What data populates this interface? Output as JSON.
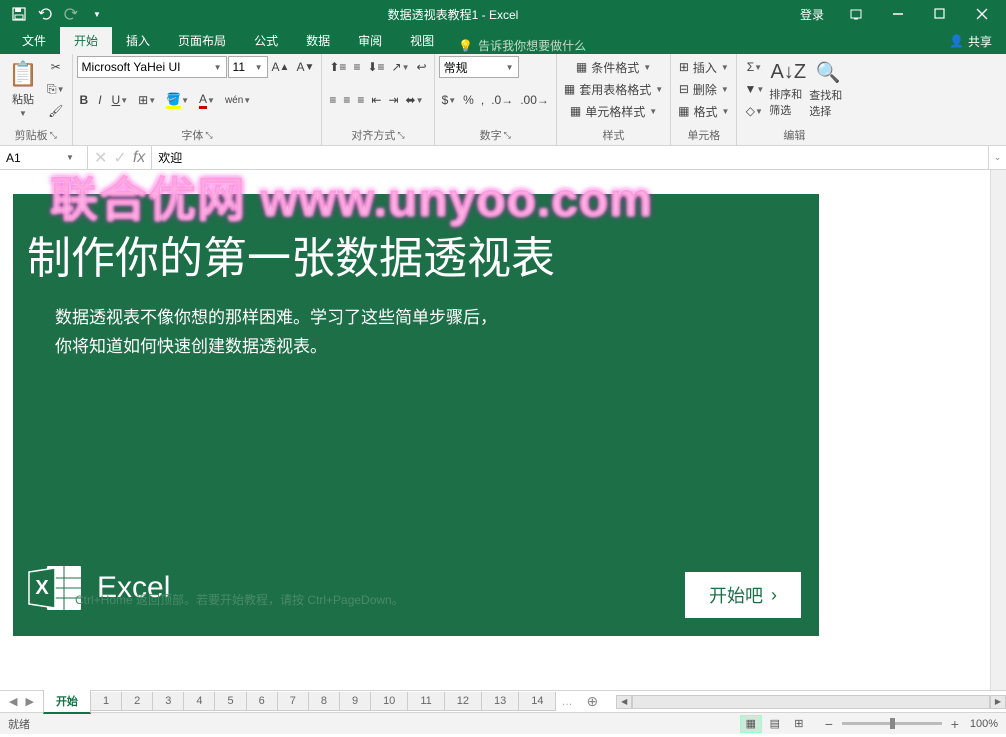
{
  "titlebar": {
    "title": "数据透视表教程1 - Excel",
    "login": "登录"
  },
  "tabs": {
    "file": "文件",
    "home": "开始",
    "insert": "插入",
    "layout": "页面布局",
    "formulas": "公式",
    "data": "数据",
    "review": "审阅",
    "view": "视图",
    "tellme": "告诉我你想要做什么",
    "share": "共享"
  },
  "ribbon": {
    "clipboard": {
      "label": "剪贴板",
      "paste": "粘贴"
    },
    "font": {
      "label": "字体",
      "name": "Microsoft YaHei UI",
      "size": "11"
    },
    "alignment": {
      "label": "对齐方式"
    },
    "number": {
      "label": "数字",
      "format": "常规"
    },
    "styles": {
      "label": "样式",
      "conditional": "条件格式",
      "table": "套用表格格式",
      "cell": "单元格样式"
    },
    "cells": {
      "label": "单元格",
      "insert": "插入",
      "delete": "删除",
      "format": "格式"
    },
    "editing": {
      "label": "编辑",
      "sort": "排序和筛选",
      "find": "查找和选择"
    }
  },
  "formula": {
    "cell": "A1",
    "value": "欢迎"
  },
  "welcome": {
    "title": "制作你的第一张数据透视表",
    "line1": "数据透视表不像你想的那样困难。学习了这些简单步骤后，",
    "line2": "你将知道如何快速创建数据透视表。",
    "product": "Excel",
    "start": "开始吧",
    "hint": "Ctrl+Home 返回顶部。若要开始教程，请按 Ctrl+PageDown。"
  },
  "sheets": {
    "active": "开始",
    "tabs": [
      "1",
      "2",
      "3",
      "4",
      "5",
      "6",
      "7",
      "8",
      "9",
      "10",
      "11",
      "12",
      "13",
      "14"
    ]
  },
  "status": {
    "ready": "就绪",
    "zoom": "100%"
  },
  "watermark": {
    "cn": "联合优网",
    "en": "www.unyoo.com"
  }
}
